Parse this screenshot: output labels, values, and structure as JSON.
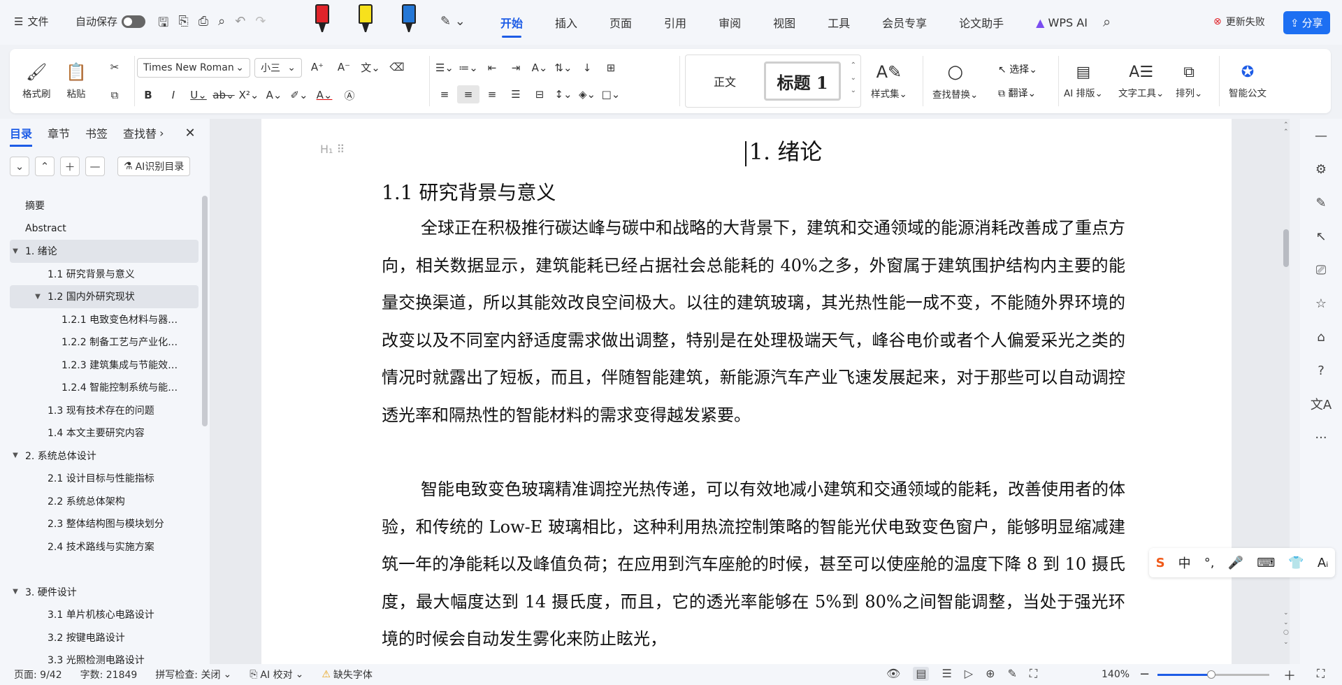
{
  "topbar": {
    "menu_label": "文件",
    "autosave_label": "自动保存",
    "tabs": [
      "开始",
      "插入",
      "页面",
      "引用",
      "审阅",
      "视图",
      "工具",
      "会员专享",
      "论文助手",
      "WPS AI"
    ],
    "active_tab": "开始",
    "update_fail": "更新失败",
    "share_label": "分享",
    "marker_colors": [
      "#e0242a",
      "#f7e11c",
      "#2477d6"
    ]
  },
  "ribbon": {
    "format_painter": "格式刷",
    "paste": "粘贴",
    "font_name": "Times New Roman",
    "font_size": "小三",
    "style_normal": "正文",
    "style_heading1": "标题 1",
    "styles_label": "样式集",
    "find_replace": "查找替换",
    "select": "选择",
    "translate": "翻译",
    "ai_layout": "AI 排版",
    "text_tools": "文字工具",
    "arrange": "排列",
    "smart_doc": "智能公文"
  },
  "sidebar": {
    "tabs": [
      "目录",
      "章节",
      "书签",
      "查找替"
    ],
    "active_tab": "目录",
    "ai_toc_label": "AI识别目录",
    "items": [
      {
        "label": "摘要",
        "level": 1,
        "arrow": ""
      },
      {
        "label": "Abstract",
        "level": 1,
        "arrow": ""
      },
      {
        "label": "1. 绪论",
        "level": 1,
        "arrow": "▼",
        "selected": true
      },
      {
        "label": "1.1 研究背景与意义",
        "level": 2,
        "arrow": ""
      },
      {
        "label": "1.2 国内外研究现状",
        "level": 2,
        "arrow": "▼",
        "selected": true
      },
      {
        "label": "1.2.1 电致变色材料与器…",
        "level": 3,
        "arrow": ""
      },
      {
        "label": "1.2.2 制备工艺与产业化…",
        "level": 3,
        "arrow": ""
      },
      {
        "label": "1.2.3 建筑集成与节能效…",
        "level": 3,
        "arrow": ""
      },
      {
        "label": "1.2.4 智能控制系统与能…",
        "level": 3,
        "arrow": ""
      },
      {
        "label": "1.3 现有技术存在的问题",
        "level": 2,
        "arrow": ""
      },
      {
        "label": "1.4 本文主要研究内容",
        "level": 2,
        "arrow": ""
      },
      {
        "label": "2. 系统总体设计",
        "level": 1,
        "arrow": "▼"
      },
      {
        "label": "2.1 设计目标与性能指标",
        "level": 2,
        "arrow": ""
      },
      {
        "label": "2.2 系统总体架构",
        "level": 2,
        "arrow": ""
      },
      {
        "label": "2.3 整体结构图与模块划分",
        "level": 2,
        "arrow": ""
      },
      {
        "label": "2.4 技术路线与实施方案",
        "level": 2,
        "arrow": ""
      },
      {
        "label": "",
        "level": 1,
        "arrow": ""
      },
      {
        "label": "3. 硬件设计",
        "level": 1,
        "arrow": "▼"
      },
      {
        "label": "3.1 单片机核心电路设计",
        "level": 2,
        "arrow": ""
      },
      {
        "label": "3.2 按键电路设计",
        "level": 2,
        "arrow": ""
      },
      {
        "label": "3.3 光照检测电路设计",
        "level": 2,
        "arrow": ""
      }
    ]
  },
  "document": {
    "heading1": "1.  绪论",
    "heading2": "1.1  研究背景与意义",
    "paragraph1": "全球正在积极推行碳达峰与碳中和战略的大背景下，建筑和交通领域的能源消耗改善成了重点方向，相关数据显示，建筑能耗已经占据社会总能耗的 40%之多，外窗属于建筑围护结构内主要的能量交换渠道，所以其能效改良空间极大。以往的建筑玻璃，其光热性能一成不变，不能随外界环境的改变以及不同室内舒适度需求做出调整，特别是在处理极端天气，峰谷电价或者个人偏爱采光之类的情况时就露出了短板，而且，伴随智能建筑，新能源汽车产业飞速发展起来，对于那些可以自动调控透光率和隔热性的智能材料的需求变得越发紧要。",
    "paragraph2": "智能电致变色玻璃精准调控光热传递，可以有效地减小建筑和交通领域的能耗，改善使用者的体验，和传统的 Low-E 玻璃相比，这种利用热流控制策略的智能光伏电致变色窗户，能够明显缩减建筑一年的净能耗以及峰值负荷；在应用到汽车座舱的时候，甚至可以使座舱的温度下降 8 到 10 摄氏度，最大幅度达到 14 摄氏度，而且，它的透光率能够在 5%到 80%之间智能调整，当处于强光环境的时候会自动发生雾化来防止眩光，"
  },
  "ime": {
    "lang": "中"
  },
  "status": {
    "page": "页面: 9/42",
    "words": "字数: 21849",
    "spell": "拼写检查: 关闭",
    "ai_proof": "AI 校对",
    "missing_font": "缺失字体",
    "zoom": "140%",
    "zoom_level_pct": 48
  }
}
